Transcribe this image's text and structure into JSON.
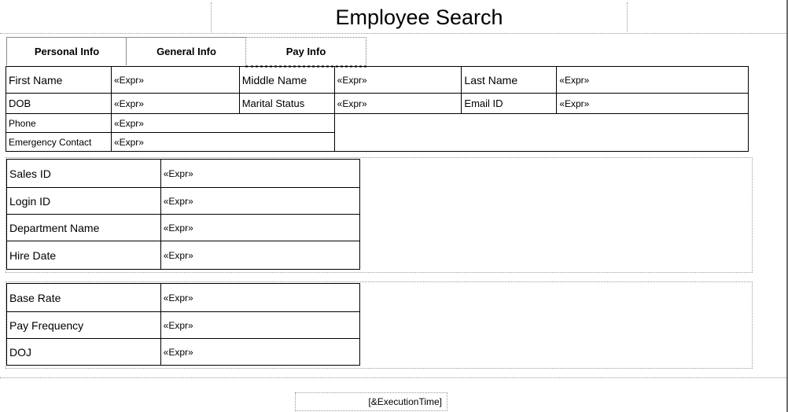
{
  "report": {
    "title": "Employee Search",
    "footer": "[&ExecutionTime]"
  },
  "tabs": [
    {
      "label": "Personal Info"
    },
    {
      "label": "General Info"
    },
    {
      "label": "Pay Info"
    }
  ],
  "personal": {
    "first_name_label": "First Name",
    "middle_name_label": "Middle Name",
    "last_name_label": "Last Name",
    "dob_label": "DOB",
    "marital_status_label": "Marital Status",
    "email_id_label": "Email ID",
    "phone_label": "Phone",
    "emergency_contact_label": "Emergency Contact",
    "expr": "«Expr»"
  },
  "general": {
    "sales_id_label": "Sales ID",
    "login_id_label": "Login ID",
    "department_name_label": "Department Name",
    "hire_date_label": "Hire Date",
    "expr": "«Expr»"
  },
  "pay": {
    "base_rate_label": "Base Rate",
    "pay_frequency_label": "Pay Frequency",
    "doj_label": "DOJ",
    "expr": "«Expr»"
  }
}
